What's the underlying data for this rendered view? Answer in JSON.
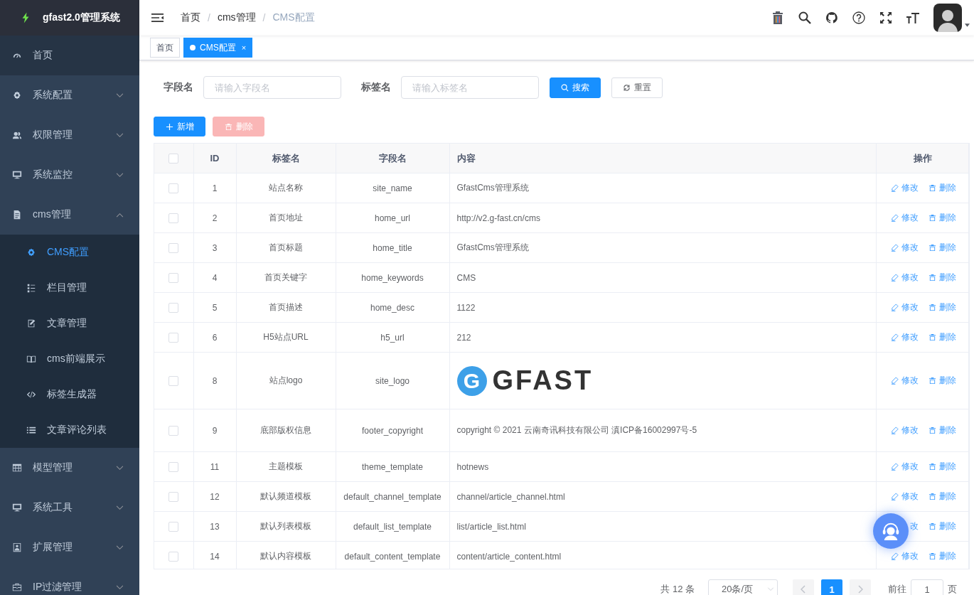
{
  "app": {
    "title": "gfast2.0管理系统"
  },
  "breadcrumb": [
    {
      "label": "首页"
    },
    {
      "separator": "/",
      "label": "cms管理"
    },
    {
      "separator": "/",
      "label": "CMS配置"
    }
  ],
  "tags": [
    {
      "label": "首页",
      "selected": false
    },
    {
      "label": "CMS配置",
      "selected": true,
      "close": "×"
    }
  ],
  "sidebar": {
    "items": [
      {
        "label": "首页",
        "hovered": true
      },
      {
        "label": "系统配置",
        "hovered": false,
        "expanded": false
      },
      {
        "label": "权限管理",
        "hovered": false,
        "expanded": false
      },
      {
        "label": "系统监控",
        "hovered": false,
        "expanded": false
      },
      {
        "label": "cms管理",
        "hovered": false,
        "expanded": true,
        "children": [
          {
            "label": "CMS配置",
            "selected": true
          },
          {
            "label": "栏目管理",
            "selected": false
          },
          {
            "label": "文章管理",
            "selected": false
          },
          {
            "label": "cms前端展示",
            "selected": false
          },
          {
            "label": "标签生成器",
            "selected": false
          },
          {
            "label": "文章评论列表",
            "selected": false
          }
        ]
      },
      {
        "label": "模型管理",
        "hovered": false,
        "expanded": false
      },
      {
        "label": "系统工具",
        "hovered": false,
        "expanded": false
      },
      {
        "label": "扩展管理",
        "hovered": false,
        "expanded": false
      },
      {
        "label": "IP过滤管理",
        "hovered": false,
        "expanded": false
      }
    ]
  },
  "search": {
    "fields": [
      {
        "label": "字段名",
        "placeholder": "请输入字段名"
      },
      {
        "label": "标签名",
        "placeholder": "请输入标签名"
      }
    ],
    "search_button": "搜索",
    "reset_button": "重置"
  },
  "toolbar": {
    "add_button": "新增",
    "delete_button": {
      "label": "删除",
      "disabled": true
    }
  },
  "table": {
    "all_checked": false,
    "columns": [
      "ID",
      "标签名",
      "字段名",
      "内容",
      "操作"
    ],
    "rows": [
      {
        "id": "1",
        "label": "站点名称",
        "field": "site_name",
        "content": "GfastCms管理系统",
        "kind": "text",
        "checked": false,
        "edit": "修改",
        "edit_icon": true,
        "delete": "删除"
      },
      {
        "id": "2",
        "label": "首页地址",
        "field": "home_url",
        "content": "http://v2.g-fast.cn/cms",
        "kind": "text",
        "checked": false,
        "edit": "修改",
        "edit_icon": true,
        "delete": "删除"
      },
      {
        "id": "3",
        "label": "首页标题",
        "field": "home_title",
        "content": "GfastCms管理系统",
        "kind": "text",
        "checked": false,
        "edit": "修改",
        "edit_icon": true,
        "delete": "删除"
      },
      {
        "id": "4",
        "label": "首页关键字",
        "field": "home_keywords",
        "content": "CMS",
        "kind": "text",
        "checked": false,
        "edit": "修改",
        "edit_icon": true,
        "delete": "删除"
      },
      {
        "id": "5",
        "label": "首页描述",
        "field": "home_desc",
        "content": "1122",
        "kind": "text",
        "checked": false,
        "edit": "修改",
        "edit_icon": true,
        "delete": "删除"
      },
      {
        "id": "6",
        "label": "H5站点URL",
        "field": "h5_url",
        "content": "212",
        "kind": "text",
        "checked": false,
        "edit": "修改",
        "edit_icon": true,
        "delete": "删除"
      },
      {
        "id": "8",
        "label": "站点logo",
        "field": "site_logo",
        "content": "GFAST",
        "logo_mark": "G",
        "kind": "logo",
        "checked": false,
        "edit": "修改",
        "edit_icon": true,
        "delete": "删除"
      },
      {
        "id": "9",
        "label": "底部版权信息",
        "field": "footer_copyright",
        "content": "copyright © 2021 云南奇讯科技有限公司 滇ICP备16002997号-5",
        "kind": "text",
        "checked": false,
        "edit": "修改",
        "edit_icon": true,
        "delete": "删除"
      },
      {
        "id": "11",
        "label": "主题模板",
        "field": "theme_template",
        "content": "hotnews",
        "kind": "text",
        "checked": false,
        "edit": "修改",
        "edit_icon": true,
        "delete": "删除"
      },
      {
        "id": "12",
        "label": "默认频道模板",
        "field": "default_channel_template",
        "content": "channel/article_channel.html",
        "kind": "text",
        "checked": false,
        "edit": "修改",
        "edit_icon": true,
        "delete": "删除"
      },
      {
        "id": "13",
        "label": "默认列表模板",
        "field": "default_list_template",
        "content": "list/article_list.html",
        "kind": "text",
        "checked": false,
        "edit": "改",
        "edit_icon": false,
        "delete": "删除"
      },
      {
        "id": "14",
        "label": "默认内容模板",
        "field": "default_content_template",
        "content": "content/article_content.html",
        "kind": "text",
        "checked": false,
        "edit": "修改",
        "edit_icon": true,
        "delete": "删除"
      }
    ]
  },
  "pagination": {
    "total": "共 12 条",
    "page_size": "20条/页",
    "pages": [
      {
        "label": "1",
        "selected": true
      }
    ],
    "goto_label": "前往",
    "goto_value": "1",
    "goto_suffix": "页"
  }
}
